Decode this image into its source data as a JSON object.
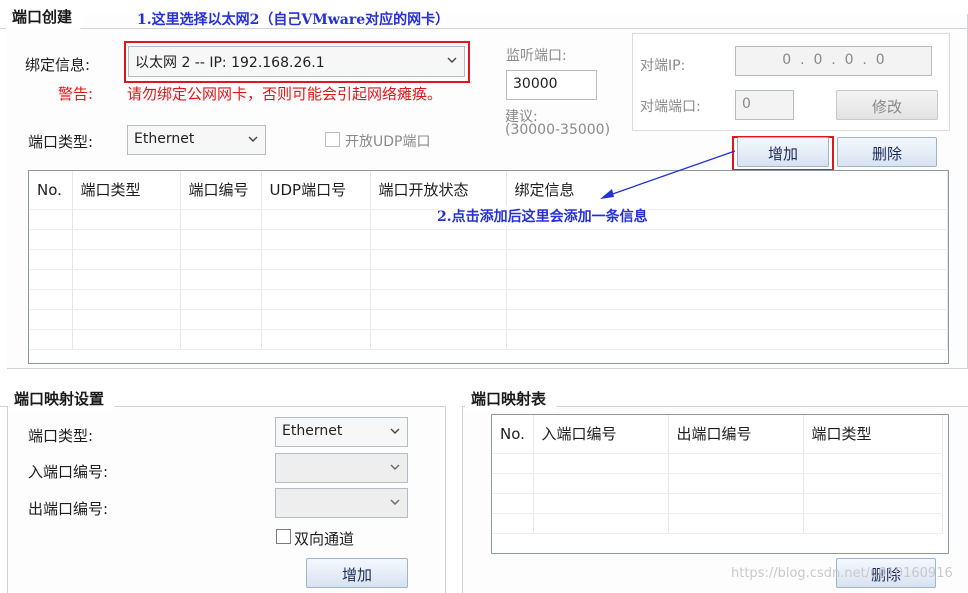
{
  "port_create": {
    "title": "端口创建",
    "bind_label": "绑定信息:",
    "bind_value": "以太网 2 -- IP: 192.168.26.1",
    "warning_label": "警告:",
    "warning_text": "请勿绑定公网网卡，否则可能会引起网络瘫痪。",
    "port_type_label": "端口类型:",
    "port_type_value": "Ethernet",
    "udp_label": "开放UDP端口",
    "listen_label": "监听端口:",
    "listen_value": "30000",
    "suggest_label": "建议:",
    "suggest_range": "(30000-35000)",
    "peer_ip_label": "对端IP:",
    "peer_ip_value": "0  .  0  .  0  .  0",
    "peer_port_label": "对端端口:",
    "peer_port_value": "0",
    "modify_button": "修改",
    "add_button": "增加",
    "delete_button": "删除",
    "table_headers": [
      "No.",
      "端口类型",
      "端口编号",
      "UDP端口号",
      "端口开放状态",
      "绑定信息"
    ]
  },
  "port_mapping": {
    "title": "端口映射设置",
    "port_type_label": "端口类型:",
    "port_type_value": "Ethernet",
    "in_port_label": "入端口编号:",
    "out_port_label": "出端口编号:",
    "bidirectional_label": "双向通道",
    "add_button": "增加"
  },
  "mapping_table": {
    "title": "端口映射表",
    "headers": [
      "No.",
      "入端口编号",
      "出端口编号",
      "端口类型"
    ],
    "delete_button": "删除"
  },
  "annotations": {
    "note1": "1.这里选择以太网2（自己VMware对应的网卡）",
    "note2": "2.点击添加后这里会添加一条信息"
  },
  "watermark": "https://blog.csdn.net/u010160916",
  "colors": {
    "annotation_blue": "#2530d8",
    "warning_red": "#e0161b",
    "highlight_red": "#e0161b"
  }
}
